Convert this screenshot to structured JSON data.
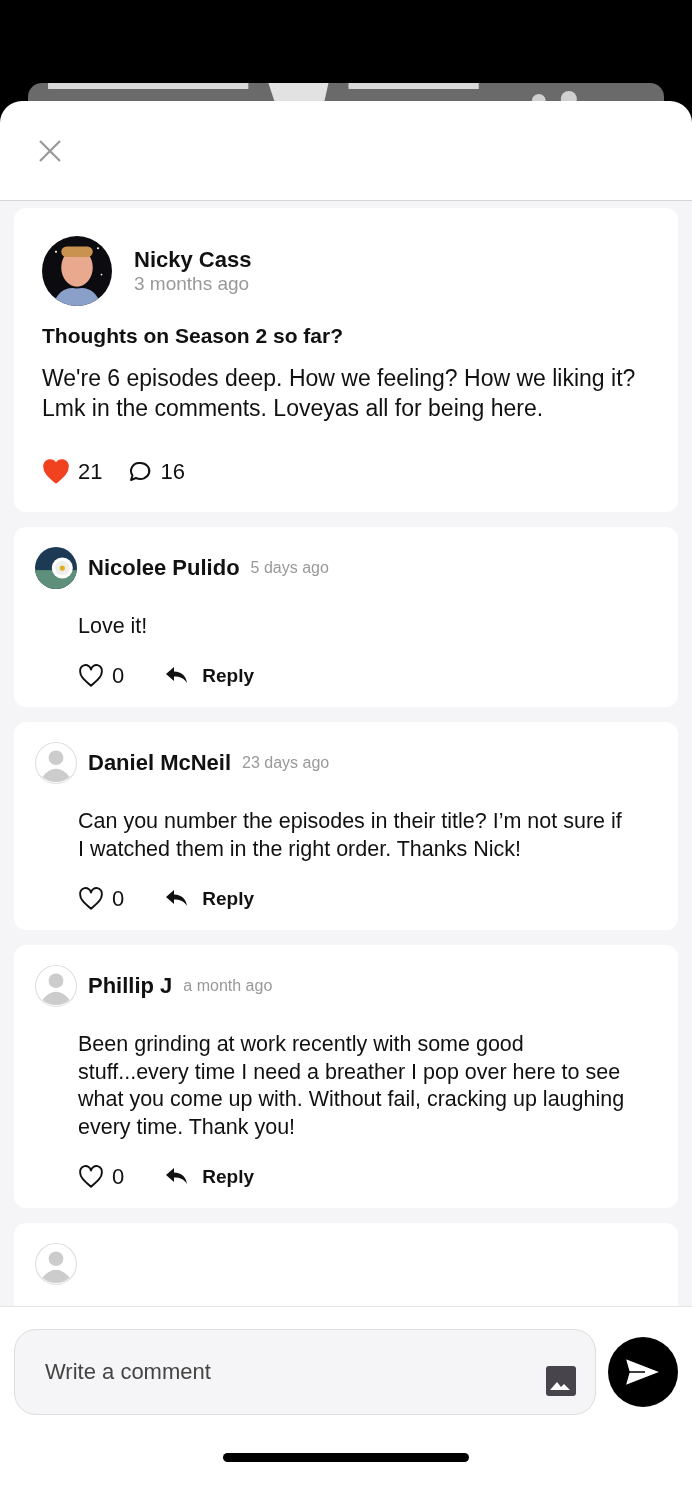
{
  "post": {
    "author": "Nicky Cass",
    "time": "3 months ago",
    "title": "Thoughts on Season 2 so far?",
    "body": "We're 6 episodes deep. How we feeling? How we liking it? Lmk in the comments. Loveyas all for being here.",
    "liked": true,
    "likes": "21",
    "comments": "16"
  },
  "comments": [
    {
      "author": "Nicolee Pulido",
      "time": "5 days ago",
      "body": "Love it!",
      "liked": false,
      "likes": "0",
      "reply": "Reply"
    },
    {
      "author": "Daniel McNeil",
      "avatar": {
        "kind": "default"
      },
      "time": "23 days ago",
      "body": "Can you number the episodes in their title? I’m not sure if I watched them in the right order. Thanks Nick!",
      "liked": false,
      "likes": "0",
      "reply": "Reply"
    },
    {
      "author": "Phillip J",
      "avatar": {
        "kind": "default"
      },
      "time": "a month ago",
      "body": "Been grinding at work recently with some good stuff...every time I need a breather I pop over here to see what you come up with. Without fail, cracking up laughing every time. Thank you!",
      "liked": false,
      "likes": "0",
      "reply": "Reply"
    }
  ],
  "composer": {
    "placeholder": "Write a comment"
  }
}
